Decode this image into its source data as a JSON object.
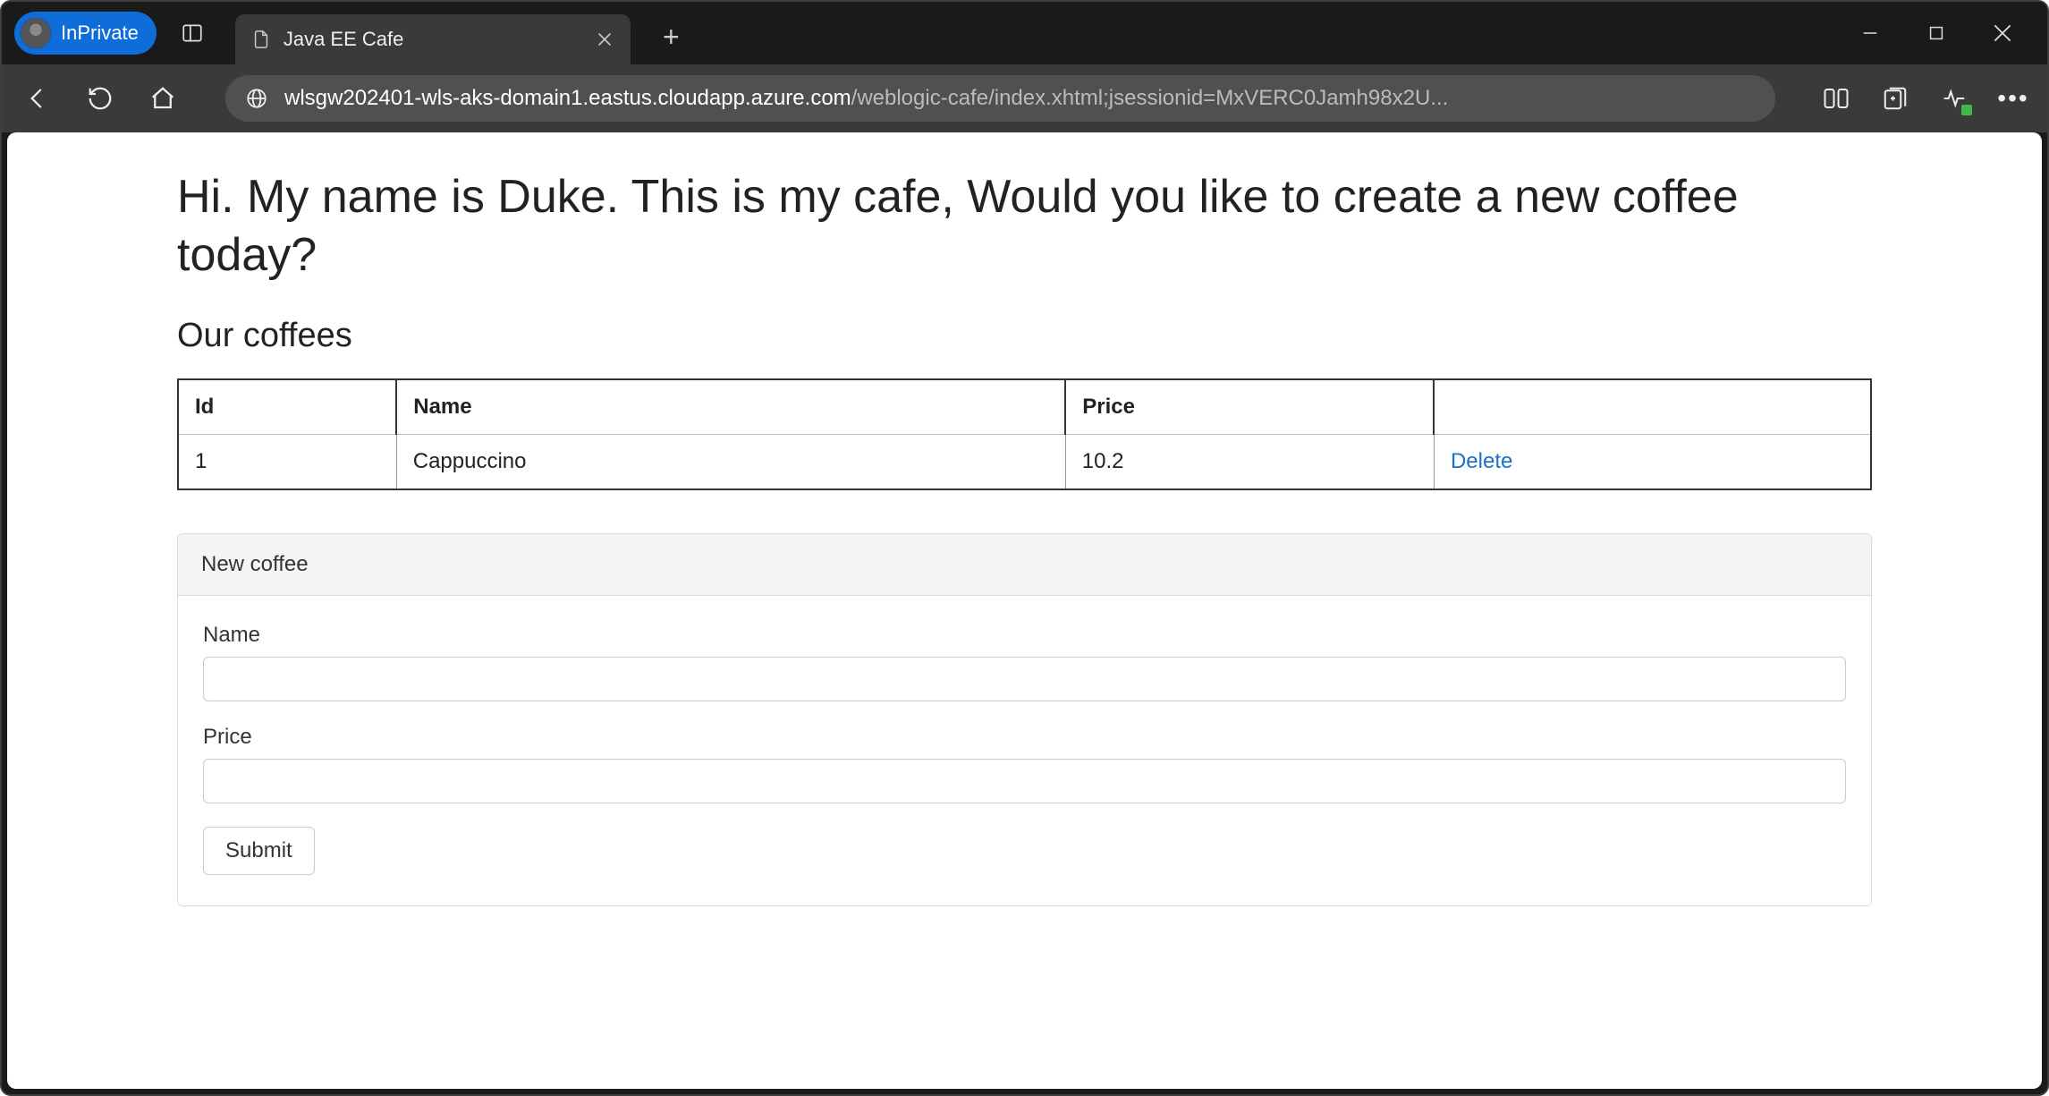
{
  "browser": {
    "inprivate_label": "InPrivate",
    "tab_title": "Java EE Cafe",
    "url_host": "wlsgw202401-wls-aks-domain1.eastus.cloudapp.azure.com",
    "url_path": "/weblogic-cafe/index.xhtml;jsessionid=MxVERC0Jamh98x2U..."
  },
  "page": {
    "heading": "Hi. My name is Duke. This is my cafe, Would you like to create a new coffee today?",
    "subheading": "Our coffees",
    "table": {
      "headers": {
        "id": "Id",
        "name": "Name",
        "price": "Price",
        "action": ""
      },
      "rows": [
        {
          "id": "1",
          "name": "Cappuccino",
          "price": "10.2",
          "action": "Delete"
        }
      ]
    },
    "form": {
      "panel_title": "New coffee",
      "name_label": "Name",
      "name_value": "",
      "price_label": "Price",
      "price_value": "",
      "submit_label": "Submit"
    }
  }
}
